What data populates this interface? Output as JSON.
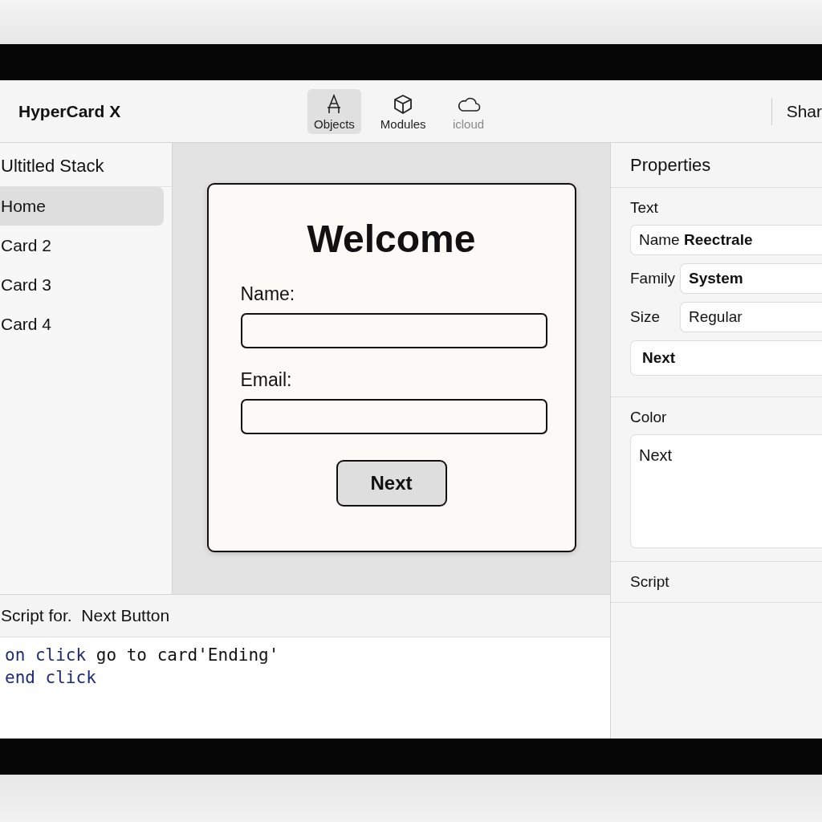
{
  "toolbar": {
    "app_title": "HyperCard X",
    "tools": [
      {
        "label": "Objects",
        "kind": "objects",
        "selected": true,
        "disabled": false
      },
      {
        "label": "Modules",
        "kind": "modules",
        "selected": false,
        "disabled": false
      },
      {
        "label": "icloud",
        "kind": "cloud",
        "selected": false,
        "disabled": true
      }
    ],
    "share_label": "Shar"
  },
  "sidebar": {
    "title": "Ultitled Stack",
    "items": [
      {
        "label": "Home",
        "selected": true
      },
      {
        "label": "Card 2",
        "selected": false
      },
      {
        "label": "Card 3",
        "selected": false
      },
      {
        "label": "Card 4",
        "selected": false
      }
    ]
  },
  "card": {
    "title": "Welcome",
    "fields": [
      {
        "label": "Name:"
      },
      {
        "label": "Email:"
      }
    ],
    "button": "Next"
  },
  "script_editor": {
    "title": "Script for.  Next Button",
    "lines": [
      {
        "keyword": "on click",
        "rest": "go to card'Ending'"
      },
      {
        "keyword": "end click"
      }
    ]
  },
  "properties": {
    "title": "Properties",
    "text_section": {
      "label": "Text",
      "name_value": "Name **Reectrale**",
      "rows": [
        {
          "label": "Family",
          "value": "System",
          "bold": true
        },
        {
          "label": "Size",
          "value": "Regular",
          "bold": false
        }
      ],
      "label_value": "Next"
    },
    "color_section": {
      "label": "Color",
      "value": "Next"
    },
    "script_section": {
      "label": "Script"
    }
  }
}
